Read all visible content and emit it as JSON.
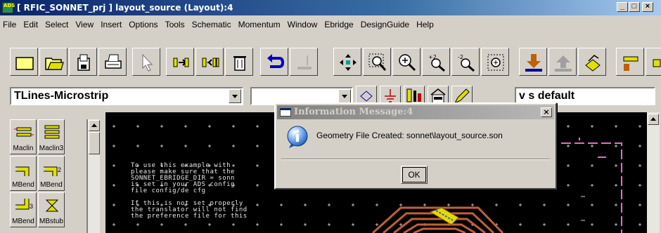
{
  "window": {
    "title": "[ RFIC_SONNET_prj ] layout_source (Layout):4",
    "app_icon_text": "ADS",
    "min_glyph": "_",
    "max_glyph": "□",
    "close_glyph": "×"
  },
  "menubar": {
    "items": [
      "File",
      "Edit",
      "Select",
      "View",
      "Insert",
      "Options",
      "Tools",
      "Schematic",
      "Momentum",
      "Window",
      "Ebridge",
      "DesignGuide",
      "Help"
    ]
  },
  "toolbar": {
    "icons": [
      "new-icon",
      "open-icon",
      "save-icon",
      "print-icon",
      "select-arrow-icon",
      "insert-port-icon",
      "insert-pin-icon",
      "delete-icon",
      "undo-icon",
      "redo-icon",
      "move-icon",
      "zoom-area-icon",
      "zoom-in-icon",
      "zoom-x2-icon",
      "zoom-out-icon",
      "zoom-fit-icon",
      "push-down-icon",
      "pop-up-icon",
      "simulate-icon",
      "ruler-icon"
    ]
  },
  "row2": {
    "palette_combo": "TLines-Microstrip",
    "second_combo": "",
    "layer_combo": "v s default"
  },
  "palette": {
    "items": [
      {
        "label": "Maclin",
        "icon": "maclin-icon"
      },
      {
        "label": "Maclin3",
        "icon": "maclin3-icon"
      },
      {
        "label": "MBend",
        "icon": "mbend-icon"
      },
      {
        "label": "MBend",
        "subscript": "2",
        "icon": "mbend2-icon"
      },
      {
        "label": "MBend",
        "subscript": "3",
        "icon": "mbend3-icon"
      },
      {
        "label": "MBstub",
        "icon": "mbstub-icon"
      }
    ]
  },
  "canvas": {
    "note_text": "To use this example with\nplease make sure that the\nSONNET_EBRIDGE_DIR = sonn\nis set in your ADS config\nfile config/de cfg\n\nIf this is not set properly\nthe translator will not find\nthe preference file for this"
  },
  "dialog": {
    "title": "Information Message:4",
    "close_glyph": "×",
    "message": "Geometry File Created: sonnet\\layout_source.son",
    "ok_label": "OK"
  },
  "colors": {
    "titlebar_start": "#0a246a",
    "canvas_bg": "#000000",
    "grid_dot": "#c0c0c0",
    "spiral": "#c0603a",
    "trace_magenta": "#e070c0",
    "via_yellow": "#e8d800"
  }
}
